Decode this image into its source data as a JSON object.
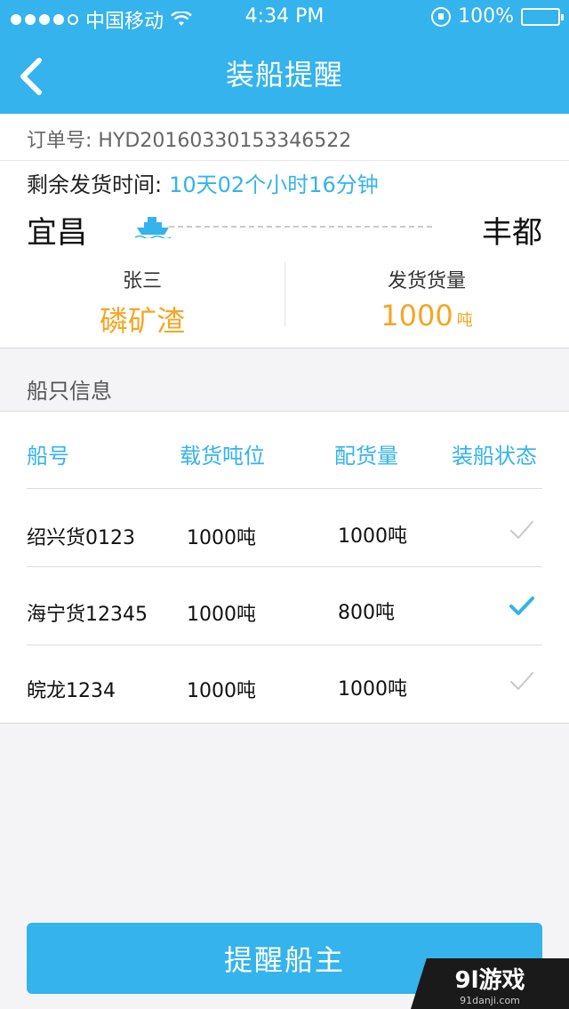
{
  "status_bar": {
    "carrier": "中国移动",
    "time": "4:34 PM",
    "battery": "100%"
  },
  "nav": {
    "title": "装船提醒"
  },
  "order": {
    "order_no_label": "订单号:",
    "order_no": "HYD20160330153346522",
    "remain_label": "剩余发货时间:",
    "remain_value": "10天02个小时16分钟",
    "from": "宜昌",
    "to": "丰都",
    "owner": "张三",
    "cargo": "磷矿渣",
    "volume_label": "发货货量",
    "volume_value": "1000",
    "volume_unit": "吨"
  },
  "ships": {
    "section_title": "船只信息",
    "headers": [
      "船号",
      "载货吨位",
      "配货量",
      "装船状态"
    ],
    "rows": [
      {
        "name": "绍兴货0123",
        "capacity": "1000吨",
        "load": "1000吨",
        "loaded": false
      },
      {
        "name": "海宁货12345",
        "capacity": "1000吨",
        "load": "800吨",
        "loaded": true
      },
      {
        "name": "皖龙1234",
        "capacity": "1000吨",
        "load": "1000吨",
        "loaded": false
      }
    ]
  },
  "actions": {
    "remind_label": "提醒船主"
  },
  "watermark": {
    "brand": "9l游戏",
    "site": "91danji.com"
  },
  "colors": {
    "accent": "#34b3ec",
    "highlight": "#f5a623"
  }
}
